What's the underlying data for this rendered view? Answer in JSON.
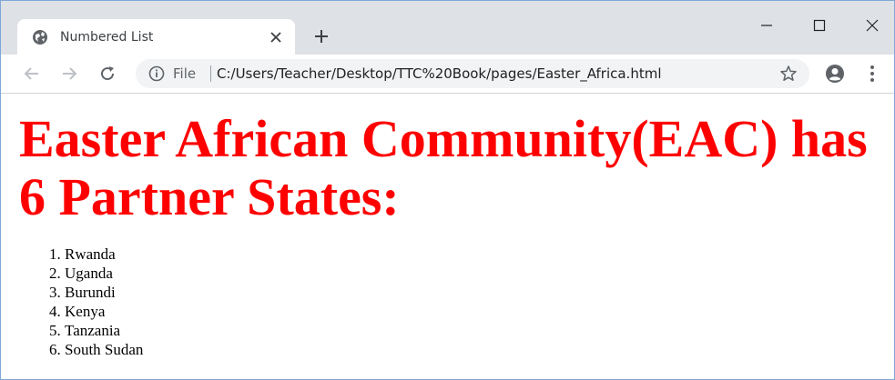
{
  "browser": {
    "tab_title": "Numbered List",
    "address_scheme": "File",
    "address_url": "C:/Users/Teacher/Desktop/TTC%20Book/pages/Easter_Africa.html"
  },
  "page": {
    "heading": "Easter African Community(EAC) has 6 Partner States:",
    "heading_color": "#ff0000",
    "list_items": [
      "Rwanda",
      "Uganda",
      "Burundi",
      "Kenya",
      "Tanzania",
      "South Sudan"
    ]
  }
}
